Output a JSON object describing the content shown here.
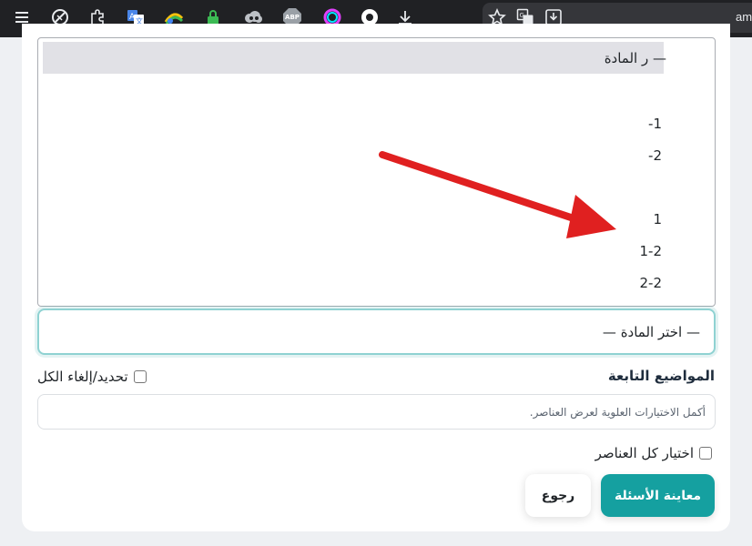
{
  "toolbar": {
    "icons": [
      "menu-icon",
      "disable-icon",
      "puzzle-icon",
      "translate-icon",
      "rainbow-icon",
      "lock-icon",
      "cloud-icon",
      "adblock-icon",
      "circle-icon",
      "opera-icon",
      "download-icon",
      "star-icon",
      "translate-page-icon",
      "save-icon"
    ],
    "adblock_label": "ABP",
    "profile_text": "am"
  },
  "listbox": {
    "selected_label": "ر المادة —",
    "options": [
      "1-",
      "2-",
      "1",
      "1-2",
      "2-2"
    ]
  },
  "subject_select": {
    "value": "— اختر المادة —"
  },
  "topics": {
    "title": "المواضيع التابعة",
    "toggle_all_label": "تحديد/إلغاء الكل",
    "hint": "أكمل الاختيارات العلوية لعرض العناصر."
  },
  "select_all_label": "اختيار كل العناصر",
  "buttons": {
    "preview": "معاينة الأسئلة",
    "back": "رجوع"
  },
  "colors": {
    "primary": "#15a0a0",
    "annotation_arrow": "#e02020",
    "toolbar": "#202124"
  }
}
